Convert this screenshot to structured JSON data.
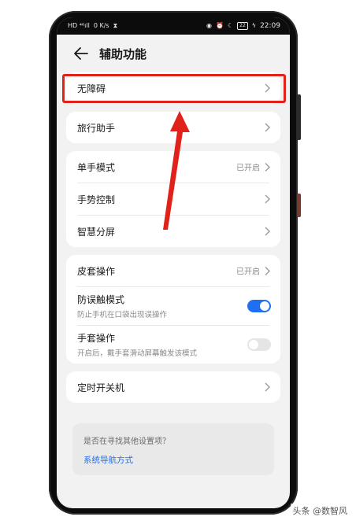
{
  "status_bar": {
    "left_signal": "HD ⁴⁶ıll",
    "speed_value": "0",
    "speed_unit": "K/s",
    "time": "22:09",
    "battery": "22"
  },
  "header": {
    "title": "辅助功能"
  },
  "groups": [
    {
      "rows": [
        {
          "label": "无障碍"
        }
      ]
    },
    {
      "rows": [
        {
          "label": "旅行助手"
        }
      ]
    },
    {
      "rows": [
        {
          "label": "单手模式",
          "status": "已开启"
        },
        {
          "label": "手势控制"
        },
        {
          "label": "智慧分屏"
        }
      ]
    },
    {
      "rows": [
        {
          "label": "皮套操作",
          "status": "已开启"
        },
        {
          "label": "防误触模式",
          "sub": "防止手机在口袋出现误操作",
          "toggle": "on"
        },
        {
          "label": "手套操作",
          "sub": "开启后，戴手套滑动屏幕触发该模式",
          "toggle": "off"
        }
      ]
    },
    {
      "rows": [
        {
          "label": "定时开关机"
        }
      ]
    }
  ],
  "hint": {
    "question": "是否在寻找其他设置项？",
    "link": "系统导航方式"
  },
  "watermark": "头条 @数智风",
  "colors": {
    "accent": "#1f6ff0",
    "annotation_red": "#e0221a"
  }
}
